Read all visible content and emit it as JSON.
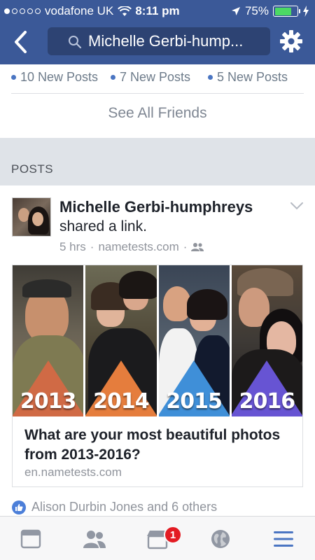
{
  "status_bar": {
    "carrier": "vodafone UK",
    "time": "8:11 pm",
    "battery_percent": "75%",
    "battery_level": 0.75,
    "signal_bars_filled": 1
  },
  "nav": {
    "search_text": "Michelle Gerbi-hump..."
  },
  "friends": {
    "new_posts": [
      "10 New Posts",
      "7 New Posts",
      "5 New Posts"
    ],
    "see_all_label": "See All Friends"
  },
  "posts_section": {
    "label": "POSTS"
  },
  "post": {
    "author": "Michelle Gerbi-humphreys",
    "action": "shared a link.",
    "time": "5 hrs",
    "source": "nametests.com",
    "separator": "·",
    "link": {
      "years": [
        "2013",
        "2014",
        "2015",
        "2016"
      ],
      "title": "What are your most beautiful photos from 2013-2016?",
      "domain": "en.nametests.com"
    },
    "likes_text": "Alison Durbin Jones and 6 others"
  },
  "tabbar": {
    "notifications_badge": "1"
  },
  "colors": {
    "header": "#3b5998",
    "accent": "#4a75c2",
    "badge": "#e31b23",
    "battery": "#4cd964"
  },
  "icons": [
    "back-icon",
    "search-icon",
    "gear-icon",
    "chevron-down-icon",
    "friends-icon",
    "like-icon",
    "news-feed-icon",
    "friend-requests-icon",
    "marketplace-icon",
    "globe-icon",
    "menu-icon"
  ]
}
